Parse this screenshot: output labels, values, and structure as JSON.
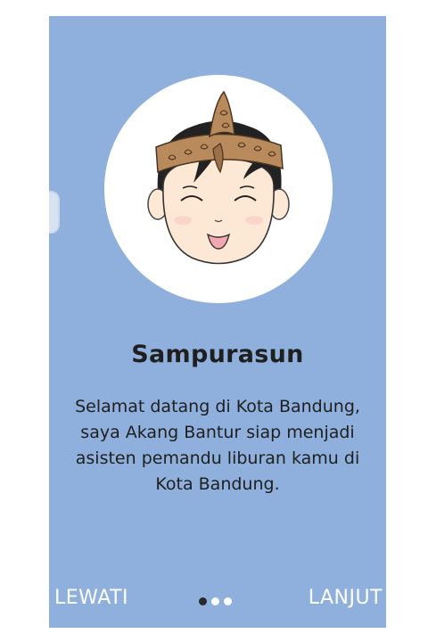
{
  "onboarding": {
    "title": "Sampurasun",
    "description": "Selamat datang di Kota Bandung, saya Akang Bantur siap menjadi asisten pemandu liburan kamu di Kota Bandung.",
    "illustration_icon": "akang-bantur-mascot-icon"
  },
  "footer": {
    "skip_label": "LEWATI",
    "next_label": "LANJUT"
  },
  "pager": {
    "total_pages": 3,
    "current_page": 1
  },
  "colors": {
    "background": "#8fb0dc",
    "title_text": "#1f1f1f",
    "button_text": "#ffffff",
    "dot_active": "#2a2a2a",
    "dot_inactive": "#ffffff"
  }
}
